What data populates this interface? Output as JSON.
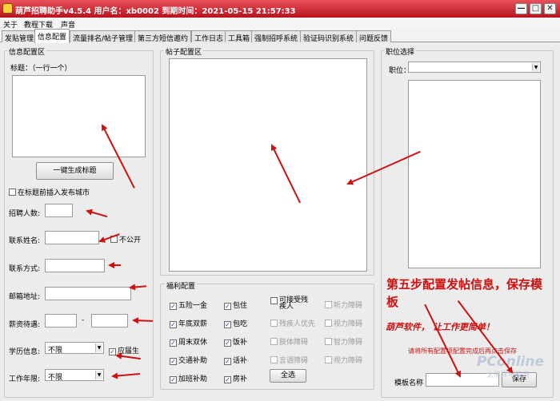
{
  "window": {
    "title": "葫芦招聘助手v4.5.4 用户名：xb0002   到期时间：2021-05-15 21:57:33",
    "minimize_glyph": "—",
    "maximize_glyph": "□",
    "close_glyph": "✕"
  },
  "menu": [
    "关于",
    "教程下载",
    "声音"
  ],
  "tabs": [
    "发贴管理",
    "信息配置",
    "流量排名/帖子管理",
    "第三方短信邀约",
    "工作日志",
    "工具箱",
    "强制招呼系统",
    "验证码识别系统",
    "问题反馈"
  ],
  "info": {
    "group": "信息配置区",
    "title_label": "标题：（一行一个）",
    "gen_button": "一键生成标题",
    "insert_city": "在标题前插入发布城市",
    "recruit_count": "招聘人数:",
    "contact_name": "联系姓名:",
    "not_public": "不公开",
    "contact_method": "联系方式:",
    "email": "邮箱地址:",
    "salary": "薪资待遇:",
    "salary_sep": "-",
    "education": "学历信息:",
    "education_value": "不限",
    "graduate": "应届生",
    "experience": "工作年限:",
    "experience_value": "不限"
  },
  "post": {
    "group": "帖子配置区"
  },
  "welfare": {
    "group": "福利配置",
    "items": [
      {
        "label": "五险一金",
        "checked": true,
        "enabled": true
      },
      {
        "label": "年底双薪",
        "checked": true,
        "enabled": true
      },
      {
        "label": "周末双休",
        "checked": true,
        "enabled": true
      },
      {
        "label": "交通补助",
        "checked": true,
        "enabled": true
      },
      {
        "label": "加班补助",
        "checked": true,
        "enabled": true
      },
      {
        "label": "包住",
        "checked": true,
        "enabled": true
      },
      {
        "label": "包吃",
        "checked": true,
        "enabled": true
      },
      {
        "label": "饭补",
        "checked": true,
        "enabled": true
      },
      {
        "label": "话补",
        "checked": true,
        "enabled": true
      },
      {
        "label": "房补",
        "checked": true,
        "enabled": true
      }
    ],
    "disability": [
      {
        "label": "可接受残疾人",
        "checked": false,
        "enabled": true
      },
      {
        "label": "残疾人优先",
        "checked": false,
        "enabled": false
      },
      {
        "label": "肢体障碍",
        "checked": false,
        "enabled": false
      },
      {
        "label": "言语障碍",
        "checked": false,
        "enabled": false
      },
      {
        "label": "听力障碍",
        "checked": false,
        "enabled": false
      },
      {
        "label": "视力障碍",
        "checked": false,
        "enabled": false
      },
      {
        "label": "智力障碍",
        "checked": false,
        "enabled": false
      },
      {
        "label": "视力障碍",
        "checked": false,
        "enabled": false
      }
    ],
    "select_all": "全选"
  },
  "position": {
    "group": "职位选择",
    "label": "职位："
  },
  "annotation": {
    "step": "第五步配置发帖信息，保存模板",
    "slogan": "葫芦软件， 让工作更简单！",
    "note": "请将所有配置项配置完成后再点击保存"
  },
  "template": {
    "label": "模板名称",
    "save": "保存"
  },
  "watermark": {
    "brand": "PConline",
    "sub": "太平洋电脑网"
  },
  "colors": {
    "titlebar": "#c8202a",
    "annotation": "#cc1111",
    "check": "#2a3c8a"
  }
}
